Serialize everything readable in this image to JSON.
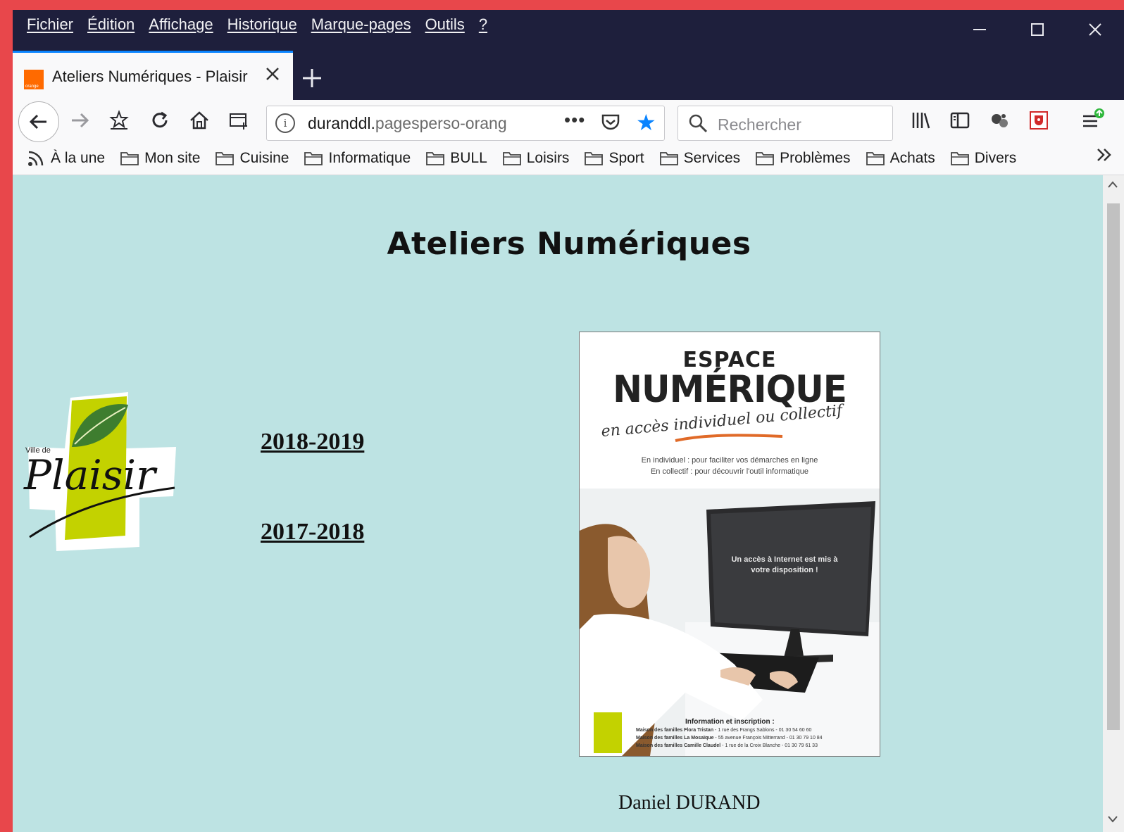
{
  "menu": {
    "items": [
      "Fichier",
      "Édition",
      "Affichage",
      "Historique",
      "Marque-pages",
      "Outils",
      "?"
    ]
  },
  "tab": {
    "title": "Ateliers Numériques - Plaisir",
    "favicon_label": "orange"
  },
  "urlbar": {
    "url_prefix": "duranddl.",
    "url_rest": "pagesperso-orang",
    "dots": "•••"
  },
  "search": {
    "placeholder": "Rechercher"
  },
  "bookmarks": {
    "rss_label": "À la une",
    "folders": [
      "Mon site",
      "Cuisine",
      "Informatique",
      "BULL",
      "Loisirs",
      "Sport",
      "Services",
      "Problèmes",
      "Achats",
      "Divers"
    ]
  },
  "page": {
    "title": "Ateliers Numériques",
    "links": [
      "2018-2019",
      "2017-2018"
    ],
    "author": "Daniel DURAND",
    "logo": {
      "small_text": "Ville de",
      "name": "Plaisir"
    }
  },
  "poster": {
    "line1": "ESPACE",
    "line2": "NUMÉRIQUE",
    "script": "en accès individuel ou collectif",
    "desc1": "En individuel : pour faciliter vos démarches en ligne",
    "desc2": "En collectif : pour découvrir l'outil informatique",
    "monitor": "Un accès à Internet est mis à votre disposition !",
    "info_title": "Information et inscription :",
    "info_lines": [
      {
        "name": "Maison des familles Flora Tristan",
        "detail": " - 1 rue des Frangs Sablons - 01 30 54 60 60"
      },
      {
        "name": "Maison des familles La Mosaïque",
        "detail": " - 55 avenue François Mitterrand - 01 30 79 10 84"
      },
      {
        "name": "Maison des familles Camille Claudel",
        "detail": " - 1 rue de la Croix Blanche - 01 30 79 61 33"
      }
    ]
  },
  "colors": {
    "chrome_dark": "#1e1f3c",
    "accent": "#0a84ff",
    "content_bg": "#bde3e3",
    "logo_green": "#c3d200"
  }
}
